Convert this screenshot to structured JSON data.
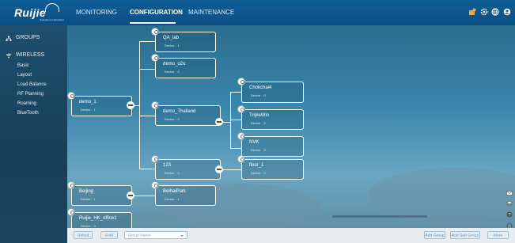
{
  "brand": {
    "logo": "Ruijie",
    "tagline": "Networks for Education"
  },
  "nav": {
    "monitoring": "MONITORING",
    "configuration": "CONFIGURATION",
    "maintenance": "MAINTENANCE"
  },
  "sidebar": {
    "groups": "GROUPS",
    "wireless": "WIRELESS",
    "items": [
      "Basic",
      "Layout",
      "Load Balance",
      "RF Planning",
      "Roaming",
      "BlueTooth"
    ]
  },
  "device_prefix": "Device :",
  "nodes": {
    "qa_lab": {
      "name": "QA_lab",
      "devices": "1"
    },
    "demo_o2o": {
      "name": "demo_o2o",
      "devices": "0"
    },
    "demo_1": {
      "name": "demo_1",
      "devices": "1"
    },
    "demo_thailand": {
      "name": "demo_Thailand",
      "devices": "0"
    },
    "chokchai4": {
      "name": "Chokchai4",
      "devices": "0"
    },
    "triplewin": {
      "name": "TripleWin",
      "devices": "0"
    },
    "nvk": {
      "name": "NVK",
      "devices": "0"
    },
    "g123": {
      "name": "123",
      "devices": "0"
    },
    "floor_1": {
      "name": "floor_1",
      "devices": "0"
    },
    "beijing": {
      "name": "Beijing",
      "devices": "1"
    },
    "beihaipark": {
      "name": "BeihaiPark",
      "devices": "1"
    },
    "ruijie_hk": {
      "name": "Ruijie_HK_office1",
      "devices": "0"
    }
  },
  "bottom": {
    "unfold": "Unfold",
    "fold": "Fold",
    "group_name_placeholder": "Group Name",
    "add_group": "Add Group",
    "add_sub_group": "Add Sub Group",
    "more": "More"
  },
  "colors": {
    "topbar": "#0f5e96",
    "accent": "#5c9ccc",
    "sidebar": "#1d4f6e"
  }
}
